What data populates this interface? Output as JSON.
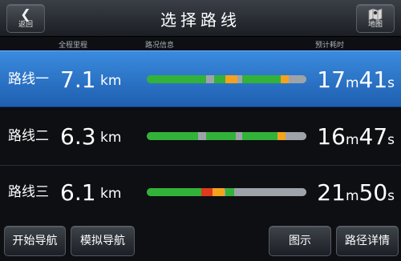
{
  "header": {
    "title": "选择路线",
    "back_label": "返回",
    "back_icon": "chevron-left-icon",
    "map_label": "地图",
    "map_icon": "map-icon"
  },
  "columns": {
    "distance": "全程里程",
    "traffic": "路况信息",
    "time": "预计耗时"
  },
  "colors": {
    "selected_row": "#2f78cf",
    "traffic_clear": "#33b23a",
    "traffic_slow": "#f5a21e",
    "traffic_jam": "#e03a1e",
    "traffic_unknown": "#9ea3aa"
  },
  "routes": [
    {
      "name": "路线一",
      "distance": "7.1",
      "distance_unit": "km",
      "time_min": "17",
      "time_min_unit": "m",
      "time_sec": "41",
      "time_sec_unit": "s",
      "selected": true,
      "traffic": [
        {
          "status": "clear",
          "from": 0.0,
          "to": 0.37
        },
        {
          "status": "unknown",
          "from": 0.37,
          "to": 0.42
        },
        {
          "status": "clear",
          "from": 0.42,
          "to": 0.49
        },
        {
          "status": "slow",
          "from": 0.49,
          "to": 0.57
        },
        {
          "status": "unknown",
          "from": 0.57,
          "to": 0.6
        },
        {
          "status": "clear",
          "from": 0.6,
          "to": 0.84
        },
        {
          "status": "slow",
          "from": 0.84,
          "to": 0.89
        },
        {
          "status": "unknown",
          "from": 0.89,
          "to": 1.0
        }
      ]
    },
    {
      "name": "路线二",
      "distance": "6.3",
      "distance_unit": "km",
      "time_min": "16",
      "time_min_unit": "m",
      "time_sec": "47",
      "time_sec_unit": "s",
      "selected": false,
      "traffic": [
        {
          "status": "clear",
          "from": 0.0,
          "to": 0.32
        },
        {
          "status": "unknown",
          "from": 0.32,
          "to": 0.37
        },
        {
          "status": "clear",
          "from": 0.37,
          "to": 0.56
        },
        {
          "status": "unknown",
          "from": 0.56,
          "to": 0.6
        },
        {
          "status": "clear",
          "from": 0.6,
          "to": 0.82
        },
        {
          "status": "slow",
          "from": 0.82,
          "to": 0.87
        },
        {
          "status": "unknown",
          "from": 0.87,
          "to": 1.0
        }
      ]
    },
    {
      "name": "路线三",
      "distance": "6.1",
      "distance_unit": "km",
      "time_min": "21",
      "time_min_unit": "m",
      "time_sec": "50",
      "time_sec_unit": "s",
      "selected": false,
      "traffic": [
        {
          "status": "clear",
          "from": 0.0,
          "to": 0.34
        },
        {
          "status": "jam",
          "from": 0.34,
          "to": 0.41
        },
        {
          "status": "slow",
          "from": 0.41,
          "to": 0.49
        },
        {
          "status": "clear",
          "from": 0.49,
          "to": 0.55
        },
        {
          "status": "unknown",
          "from": 0.55,
          "to": 1.0
        }
      ]
    }
  ],
  "footer": {
    "start_nav": "开始导航",
    "simulate_nav": "模拟导航",
    "diagram": "图示",
    "route_details": "路径详情"
  }
}
